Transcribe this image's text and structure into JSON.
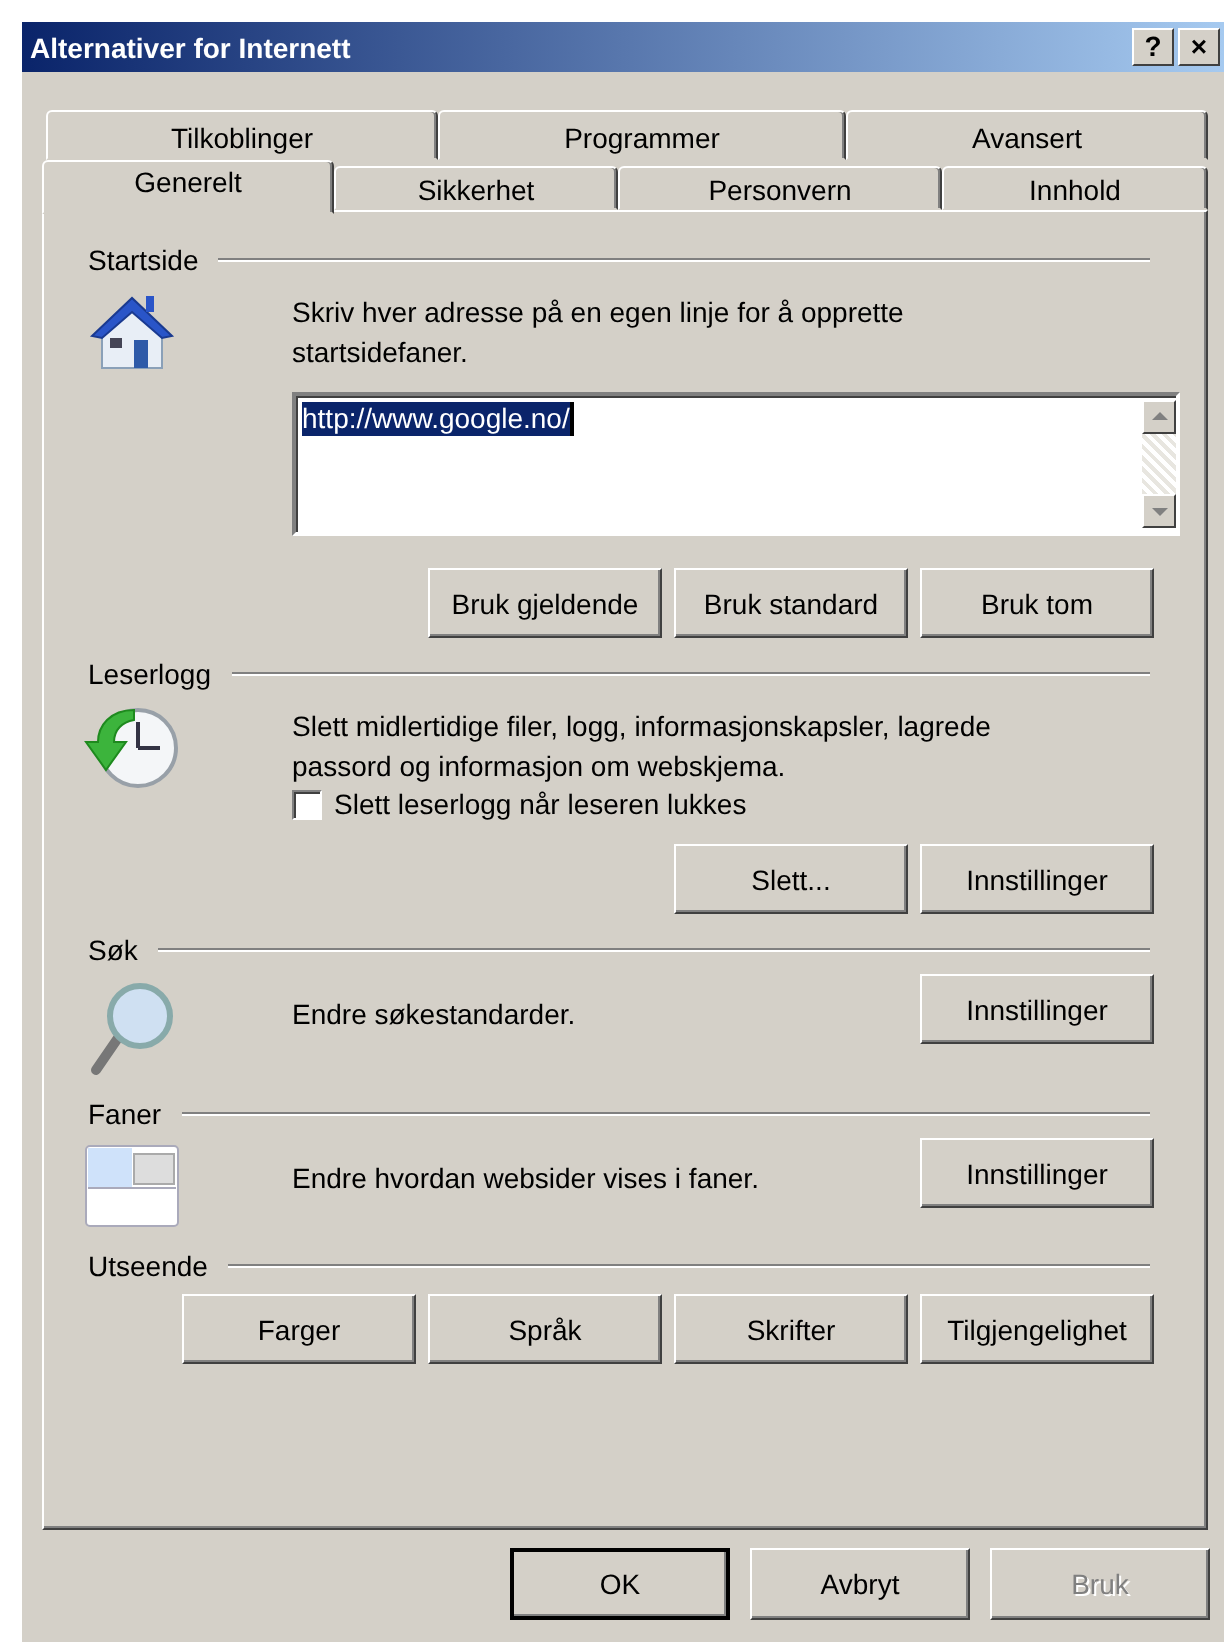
{
  "window": {
    "title": "Alternativer for Internett",
    "title_buttons": [
      "?",
      "×"
    ]
  },
  "tab_rows": [
    {
      "tabs": [
        {
          "label": "Tilkoblinger",
          "selected": false
        },
        {
          "label": "Programmer",
          "selected": false
        },
        {
          "label": "Avansert",
          "selected": false
        }
      ]
    },
    {
      "tabs": [
        {
          "label": "Generelt",
          "selected": true
        },
        {
          "label": "Sikkerhet",
          "selected": false
        },
        {
          "label": "Personvern",
          "selected": false
        },
        {
          "label": "Innhold",
          "selected": false
        }
      ]
    }
  ],
  "sections": [
    {
      "kind": "homepage",
      "title": "Startside",
      "description": "Skriv hver adresse på en egen linje for å opprette startsidefaner.",
      "field": {
        "value": "http://www.google.no/",
        "selected": true
      },
      "buttons": [
        {
          "label": "Bruk gjeldende"
        },
        {
          "label": "Bruk standard"
        },
        {
          "label": "Bruk tom"
        }
      ]
    },
    {
      "kind": "history",
      "title": "Leserlogg",
      "description": "Slett midlertidige filer, logg, informasjonskapsler, lagrede passord og informasjon om webskjema.",
      "checkbox": {
        "label": "Slett leserlogg når leseren lukkes",
        "checked": false
      },
      "buttons": [
        {
          "label": "Slett..."
        },
        {
          "label": "Innstillinger"
        }
      ]
    },
    {
      "kind": "search",
      "title": "Søk",
      "description": "Endre søkestandarder.",
      "buttons": [
        {
          "label": "Innstillinger"
        }
      ]
    },
    {
      "kind": "tabs",
      "title": "Faner",
      "description": "Endre hvordan websider vises i faner.",
      "buttons": [
        {
          "label": "Innstillinger"
        }
      ]
    },
    {
      "kind": "appearance",
      "title": "Utseende",
      "buttons": [
        {
          "label": "Farger"
        },
        {
          "label": "Språk"
        },
        {
          "label": "Skrifter"
        },
        {
          "label": "Tilgjengelighet"
        }
      ]
    }
  ],
  "dialog_buttons": [
    {
      "label": "OK",
      "default": true,
      "disabled": false
    },
    {
      "label": "Avbryt",
      "default": false,
      "disabled": false
    },
    {
      "label": "Bruk",
      "default": false,
      "disabled": true
    }
  ]
}
